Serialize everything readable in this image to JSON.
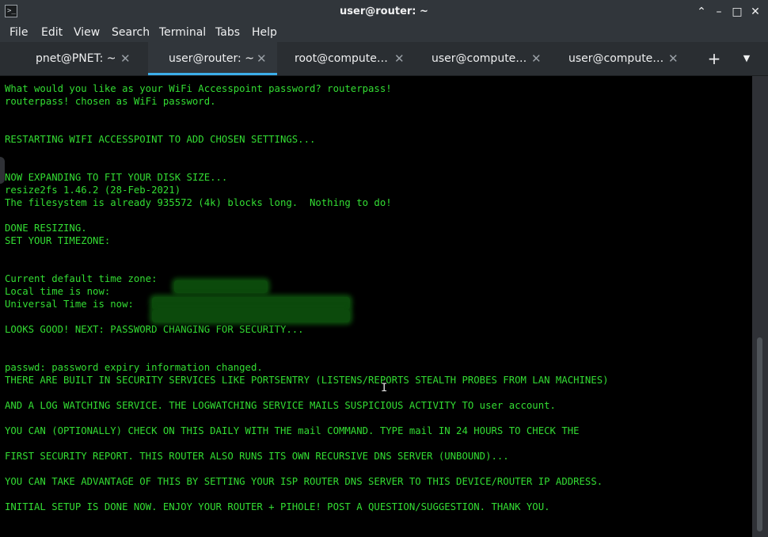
{
  "window": {
    "title": "user@router: ~",
    "app_icon": "terminal-icon",
    "controls": {
      "up": "⌃",
      "minimize": "–",
      "maximize": "□",
      "close": "✕"
    }
  },
  "menu": [
    "File",
    "Edit",
    "View",
    "Search",
    "Terminal",
    "Tabs",
    "Help"
  ],
  "tabs": [
    {
      "label": "pnet@PNET: ~",
      "active": false
    },
    {
      "label": "user@router: ~",
      "active": true
    },
    {
      "label": "root@compute…",
      "active": false
    },
    {
      "label": "user@compute…",
      "active": false
    },
    {
      "label": "user@compute…",
      "active": false
    }
  ],
  "tab_controls": {
    "add": "+",
    "menu": "▼",
    "close_glyph": "✕"
  },
  "terminal": {
    "lines": [
      "What would you like as your WiFi Accesspoint password? routerpass!",
      "routerpass! chosen as WiFi password.",
      "",
      "",
      "RESTARTING WIFI ACCESSPOINT TO ADD CHOSEN SETTINGS...",
      "",
      "",
      "NOW EXPANDING TO FIT YOUR DISK SIZE...",
      "resize2fs 1.46.2 (28-Feb-2021)",
      "The filesystem is already 935572 (4k) blocks long.  Nothing to do!",
      "",
      "DONE RESIZING.",
      "SET YOUR TIMEZONE:",
      "",
      "",
      "Current default time zone:",
      "Local time is now:",
      "Universal Time is now:",
      "",
      "LOOKS GOOD! NEXT: PASSWORD CHANGING FOR SECURITY...",
      "",
      "",
      "passwd: password expiry information changed.",
      "THERE ARE BUILT IN SECURITY SERVICES LIKE PORTSENTRY (LISTENS/REPORTS STEALTH PROBES FROM LAN MACHINES)",
      "",
      "AND A LOG WATCHING SERVICE. THE LOGWATCHING SERVICE MAILS SUSPICIOUS ACTIVITY TO user account.",
      "",
      "YOU CAN (OPTIONALLY) CHECK ON THIS DAILY WITH THE mail COMMAND. TYPE mail IN 24 HOURS TO CHECK THE",
      "",
      "FIRST SECURITY REPORT. THIS ROUTER ALSO RUNS ITS OWN RECURSIVE DNS SERVER (UNBOUND)...",
      "",
      "YOU CAN TAKE ADVANTAGE OF THIS BY SETTING YOUR ISP ROUTER DNS SERVER TO THIS DEVICE/ROUTER IP ADDRESS.",
      "",
      "INITIAL SETUP IS DONE NOW. ENJOY YOUR ROUTER + PIHOLE! POST A QUESTION/SUGGESTION. THANK YOU."
    ]
  },
  "colors": {
    "terminal_text": "#33dd33",
    "terminal_bg": "#000000",
    "chrome_bg": "#31363b",
    "active_tab_accent": "#3daee9"
  }
}
